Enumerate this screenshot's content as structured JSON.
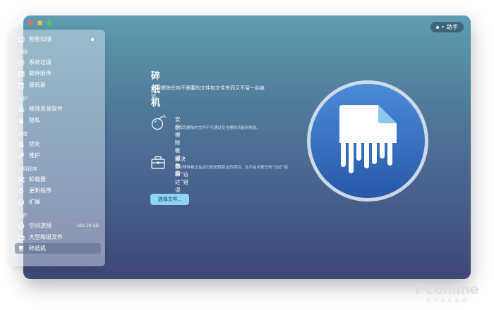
{
  "window": {
    "traffic_lights": {
      "red": "#ee6a5e",
      "yellow": "#f5bd4f",
      "green": "#61c454"
    }
  },
  "header": {
    "assistant_label": "助手"
  },
  "sidebar": {
    "top_item": {
      "label": "智能扫描",
      "icon": "scan-icon"
    },
    "sections": {
      "cleanup": "清理",
      "protection": "保护",
      "speed": "速度",
      "applications": "应用程序",
      "files": "文件"
    },
    "items": {
      "system_junk": {
        "label": "系统垃圾",
        "icon": "disc-icon"
      },
      "mail_attachments": {
        "label": "邮件附件",
        "icon": "envelope-icon"
      },
      "trash_bins": {
        "label": "废纸篓",
        "icon": "trash-icon"
      },
      "malware_removal": {
        "label": "移除恶意软件",
        "icon": "biohazard-icon"
      },
      "privacy": {
        "label": "隐私",
        "icon": "hand-icon"
      },
      "optimization": {
        "label": "优化",
        "icon": "sliders-icon"
      },
      "maintenance": {
        "label": "维护",
        "icon": "wrench-icon"
      },
      "uninstaller": {
        "label": "卸载器",
        "icon": "uninstaller-icon"
      },
      "updater": {
        "label": "更新程序",
        "icon": "update-icon"
      },
      "extensions": {
        "label": "扩展",
        "icon": "extension-icon"
      },
      "space_lens": {
        "label": "空间透镜",
        "icon": "lens-icon",
        "extra": "189.38 GB"
      },
      "large_old_files": {
        "label": "大型和旧文件",
        "icon": "folder-icon"
      },
      "shredder": {
        "label": "碎纸机",
        "icon": "shredder-icon",
        "active": true
      }
    }
  },
  "main": {
    "title": "碎纸机",
    "description": "迅速擦除任何不需要的文件和文件夹而又不留一丝痕迹。",
    "features": [
      {
        "title": "安全擦除敏感数据",
        "desc": "确保您擦除的文件不可通过安全擦除功能来恢复。",
        "icon": "bomb-icon"
      },
      {
        "title": "解决各种“访达”错误",
        "desc": "轻松移除被正在运行的进程锁定的项目，且不会出现任何“访达”错误。",
        "icon": "toolbox-icon"
      }
    ],
    "select_button": "选择文件...",
    "hero_icon": "shredder-app-icon"
  },
  "watermark": {
    "brand": "PConline",
    "sub": "太平洋电脑网"
  },
  "colors": {
    "accent_button": "#8fd3f7",
    "hero_circle": "#2f6fc0",
    "window_top": "#5e9db2",
    "window_bottom": "#3e4776"
  }
}
